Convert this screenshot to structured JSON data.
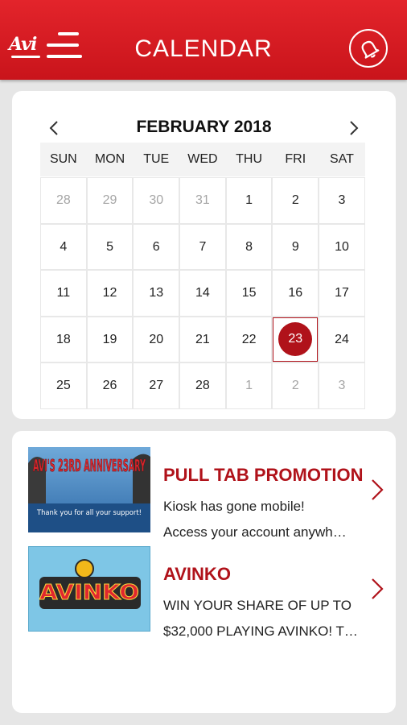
{
  "header": {
    "logo_text": "Avi",
    "title": "CALENDAR",
    "icons": {
      "menu": "menu-icon",
      "notification": "bell-icon"
    },
    "colors": {
      "brand": "#d11d24",
      "accent": "#b0121a"
    }
  },
  "calendar": {
    "month_label": "FEBRUARY 2018",
    "weekdays": [
      "SUN",
      "MON",
      "TUE",
      "WED",
      "THU",
      "FRI",
      "SAT"
    ],
    "weeks": [
      [
        "28",
        "29",
        "30",
        "31",
        "1",
        "2",
        "3"
      ],
      [
        "4",
        "5",
        "6",
        "7",
        "8",
        "9",
        "10"
      ],
      [
        "11",
        "12",
        "13",
        "14",
        "15",
        "16",
        "17"
      ],
      [
        "18",
        "19",
        "20",
        "21",
        "22",
        "23",
        "24"
      ],
      [
        "25",
        "26",
        "27",
        "28",
        "1",
        "2",
        "3"
      ]
    ],
    "selected_day": "23"
  },
  "events": [
    {
      "title": "PULL TAB PROMOTION",
      "desc_line1": "Kiosk has gone mobile!",
      "desc_line2": "Access your account anywh…",
      "image_text": "AVI'S 23RD ANNIVERSARY",
      "image_caption": "Thank you for all your support!"
    },
    {
      "title": "AVINKO",
      "desc_line1": "WIN YOUR SHARE OF UP TO",
      "desc_line2": "$32,000 PLAYING AVINKO! T…",
      "image_text": "AVINKO"
    }
  ]
}
